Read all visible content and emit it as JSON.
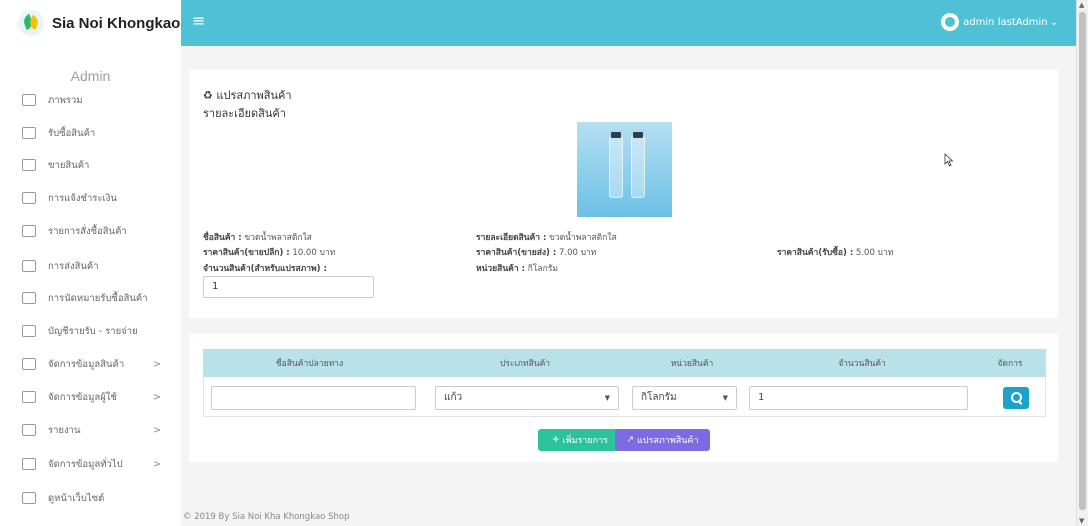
{
  "brand": {
    "name": "Sia Noi Khongkao"
  },
  "user": {
    "name": "admin lastAdmin",
    "caret": "⌄"
  },
  "sidebar": {
    "title": "Admin",
    "items": [
      {
        "label": "ภาพรวม",
        "icon": "dashboard-icon",
        "has_children": false
      },
      {
        "label": "รับซื้อสินค้า",
        "icon": "box-icon",
        "has_children": false
      },
      {
        "label": "ขายสินค้า",
        "icon": "register-icon",
        "has_children": false
      },
      {
        "label": "การแจ้งชำระเงิน",
        "icon": "wallet-icon",
        "has_children": false
      },
      {
        "label": "รายการสั่งซื้อสินค้า",
        "icon": "list-icon",
        "has_children": false
      },
      {
        "label": "การส่งสินค้า",
        "icon": "box-icon",
        "has_children": false
      },
      {
        "label": "การนัดหมายรับซื้อสินค้า",
        "icon": "calendar-icon",
        "has_children": false
      },
      {
        "label": "บัญชีรายรับ - รายจ่าย",
        "icon": "ledger-icon",
        "has_children": false
      },
      {
        "label": "จัดการข้อมูลสินค้า",
        "icon": "product-icon",
        "has_children": true
      },
      {
        "label": "จัดการข้อมูลผู้ใช้",
        "icon": "user-icon",
        "has_children": true
      },
      {
        "label": "รายงาน",
        "icon": "report-icon",
        "has_children": true
      },
      {
        "label": "จัดการข้อมูลทั่วไป",
        "icon": "settings-icon",
        "has_children": true
      },
      {
        "label": "ดูหน้าเว็บไซต์",
        "icon": "monitor-icon",
        "has_children": false
      }
    ],
    "chevron": ">"
  },
  "page": {
    "title_icon": "♻",
    "title": "แปรสภาพสินค้า",
    "subtitle": "รายละเอียดสินค้า"
  },
  "product": {
    "name_label": "ชื่อสินค้า :",
    "name": "ขวดน้ำพลาสติกใส",
    "detail_label": "รายละเอียดสินค้า :",
    "detail": "ขวดน้ำพลาสติกใส",
    "retail_label": "ราคาสินค้า(ขายปลีก) :",
    "retail": "10.00 บาท",
    "wholesale_label": "ราคาสินค้า(ขายส่ง) :",
    "wholesale": "7.00 บาท",
    "buy_label": "ราคาสินค้า(รับซื้อ) :",
    "buy": "5.00 บาท",
    "qty_label": "จำนวนสินค้า(สำหรับแปรสภาพ) :",
    "qty": "1",
    "unit_label": "หน่วยสินค้า :",
    "unit": "กิโลกรัม"
  },
  "table": {
    "headers": [
      "ชื่อสินค้าปลายทาง",
      "ประเภทสินค้า",
      "หน่วยสินค้า",
      "จำนวนสินค้า",
      "จัดการ"
    ],
    "row": {
      "target_name": "",
      "type": "แก้ว",
      "unit": "กิโลกรัม",
      "qty": "1",
      "dropdown": "▼"
    }
  },
  "buttons": {
    "add": "เพิ่มรายการ",
    "add_icon": "+",
    "convert": "แปรสภาพสินค้า",
    "convert_icon": "↗"
  },
  "footer": {
    "text": "© 2019 By Sia Noi Kha Khongkao Shop"
  },
  "colors": {
    "accent": "#4fc1d6",
    "add_button": "#2cc39b",
    "convert_button": "#7c6be3",
    "search_button": "#1aa3c9"
  }
}
